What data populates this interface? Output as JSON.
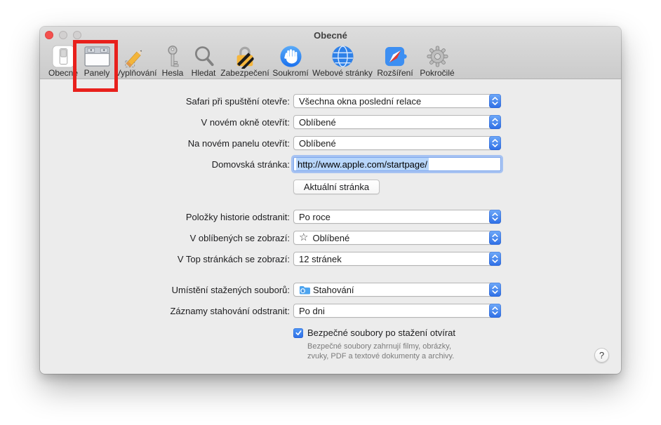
{
  "window": {
    "title": "Obecné",
    "help": "?"
  },
  "toolbar": {
    "items": [
      {
        "label": "Obecné"
      },
      {
        "label": "Panely"
      },
      {
        "label": "Vyplňování"
      },
      {
        "label": "Hesla"
      },
      {
        "label": "Hledat"
      },
      {
        "label": "Zabezpečení"
      },
      {
        "label": "Soukromí"
      },
      {
        "label": "Webové stránky"
      },
      {
        "label": "Rozšíření"
      },
      {
        "label": "Pokročilé"
      }
    ],
    "selected": "Obecné",
    "annotation": "red-highlight-box-around-Panely"
  },
  "form": {
    "selects": [
      {
        "label": "Safari při spuštění otevře:",
        "value": "Všechna okna poslední relace"
      },
      {
        "label": "V novém okně otevřít:",
        "value": "Oblíbené"
      },
      {
        "label": "Na novém panelu otevřít:",
        "value": "Oblíbené"
      },
      {
        "label": "Položky historie odstranit:",
        "value": "Po roce"
      },
      {
        "label": "V oblíbených se zobrazí:",
        "value": "Oblíbené"
      },
      {
        "label": "V Top stránkách se zobrazí:",
        "value": "12 stránek"
      },
      {
        "label": "Umístění stažených souborů:",
        "value": "Stahování"
      },
      {
        "label": "Záznamy stahování odstranit:",
        "value": "Po dni"
      }
    ],
    "star_glyph": "☆",
    "homepage_label": "Domovská stránka:",
    "homepage_value": "http://www.apple.com/startpage/",
    "current_page_button": "Aktuální stránka",
    "safe_files": {
      "label": "Bezpečné soubory po stažení otvírat",
      "checked": true,
      "note_line1": "Bezpečné soubory zahrnují filmy, obrázky,",
      "note_line2": "zvuky, PDF a textové dokumenty a archivy."
    }
  },
  "colors": {
    "accent_blue": "#2e6fe6",
    "annotation_red": "#e8201c",
    "selection_blue": "#b8d6fb",
    "window_bg": "#ececec"
  }
}
